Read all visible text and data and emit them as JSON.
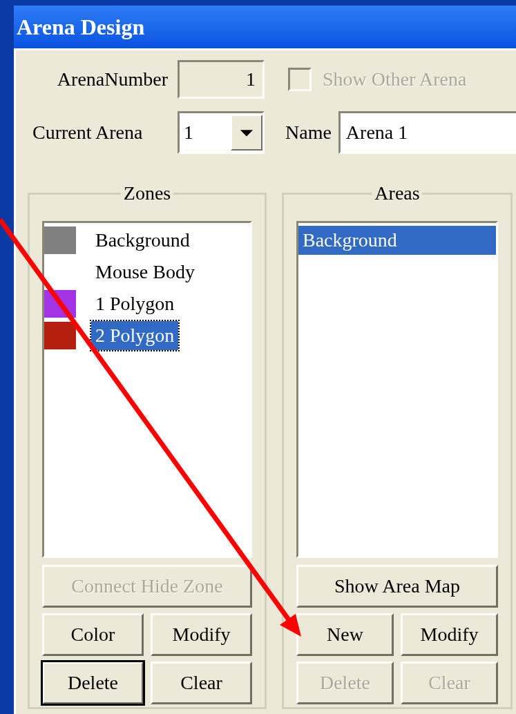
{
  "window": {
    "title": "Arena Design"
  },
  "arena_number": {
    "label": "ArenaNumber",
    "value": "1"
  },
  "show_other_arena": {
    "label": "Show Other Arena",
    "checked": false,
    "disabled": true
  },
  "current_arena": {
    "label": "Current Arena",
    "value": "1"
  },
  "name": {
    "label": "Name",
    "value": "Arena 1"
  },
  "zones": {
    "title": "Zones",
    "items": [
      {
        "label": "Background",
        "color": "#808080",
        "selected": false
      },
      {
        "label": "Mouse Body",
        "selected": false
      },
      {
        "label": "1 Polygon",
        "color": "#a433e6",
        "selected": false
      },
      {
        "label": "2 Polygon",
        "color": "#b5200e",
        "selected": true
      }
    ],
    "buttons": [
      {
        "label": "Connect Hide Zone",
        "disabled": true,
        "default": false
      },
      {
        "label": "Color",
        "disabled": false,
        "default": false
      },
      {
        "label": "Modify",
        "disabled": false,
        "default": false
      },
      {
        "label": "Delete",
        "disabled": false,
        "default": true
      },
      {
        "label": "Clear",
        "disabled": false,
        "default": false
      }
    ]
  },
  "areas": {
    "title": "Areas",
    "items": [
      {
        "label": "Background",
        "selected": true
      }
    ],
    "buttons": [
      {
        "label": "Show Area Map",
        "disabled": false,
        "default": false
      },
      {
        "label": "New",
        "disabled": false,
        "default": false
      },
      {
        "label": "Modify",
        "disabled": false,
        "default": false
      },
      {
        "label": "Delete",
        "disabled": true,
        "default": false
      },
      {
        "label": "Clear",
        "disabled": true,
        "default": false
      }
    ]
  }
}
